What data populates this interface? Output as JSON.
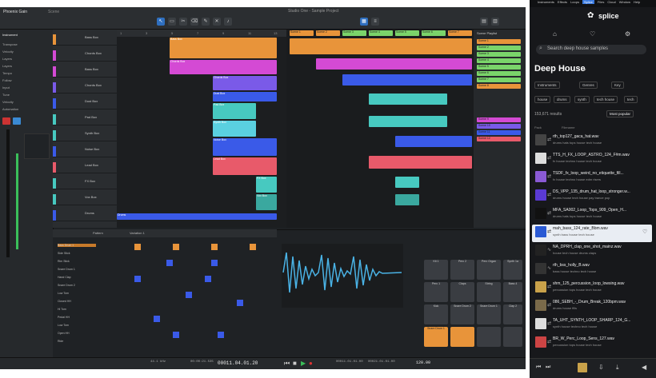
{
  "daw": {
    "project": "Phoenix Gain",
    "project_sub": "Scene",
    "window_title": "Studio One - Sample Project",
    "inspector_title": "Instrument",
    "inspector_rows": [
      "Transpose",
      "Velocity",
      "Layers",
      "Layers",
      "Tempo",
      "Follow",
      "Input",
      "Tune",
      "Velocity",
      "Automation"
    ],
    "tracks": [
      {
        "name": "Bass Box",
        "color": "#e8943a"
      },
      {
        "name": "Chords Box",
        "color": "#d44ad4"
      },
      {
        "name": "Bass Box",
        "color": "#d44ad4"
      },
      {
        "name": "Chords Box",
        "color": "#7a5ae8"
      },
      {
        "name": "Dust Box",
        "color": "#3a5ae8"
      },
      {
        "name": "Pad Box",
        "color": "#47c9c0"
      },
      {
        "name": "Synth Box",
        "color": "#47c9c0"
      },
      {
        "name": "Noise Box",
        "color": "#3a5ae8"
      },
      {
        "name": "Lead Box",
        "color": "#e85a6a"
      },
      {
        "name": "FX Box",
        "color": "#47c9c0"
      },
      {
        "name": "Vox Box",
        "color": "#47c9c0"
      },
      {
        "name": "Drums",
        "color": "#3a5ae8"
      }
    ],
    "ruler_marks": [
      "1",
      "3",
      "5",
      "7",
      "9",
      "11",
      "13"
    ],
    "scene_headers": [
      "Scene 1",
      "Scene 2",
      "Scene 3",
      "Scene 4",
      "Scene 5",
      "Scene 6",
      "Scene 7"
    ],
    "scene_panel_title": "Scene Playlist",
    "scene_items": [
      "Scene 1",
      "Scene 2",
      "Scene 3",
      "Scene 4",
      "Scene 5",
      "Scene 6",
      "Scene 7",
      "Scene 8",
      "Scene 9",
      "Scene 10",
      "Scene 11",
      "Scene 12"
    ],
    "pattern_label": "Pattern",
    "pattern_name": "Variation 1",
    "pattern_rows": [
      "Bass Drum 1",
      "Side Stick",
      "Rim Stick",
      "Snare Drum 1",
      "Hand Clap",
      "Snare Drum 2",
      "Low Tom",
      "Closed HH",
      "Hi Tom",
      "Pedal HH",
      "Low Tom",
      "Open HH",
      "Ride"
    ],
    "pad_labels": [
      "Kit 1",
      "Perc 2",
      "Perc Organ",
      "Synth 1a",
      "Perc 1",
      "Claps",
      "String",
      "Bass 4",
      "Kick",
      "Snare Drum 2",
      "Snare Drum 1",
      "Clap 2",
      "Snare Drum 1",
      "",
      "",
      ""
    ],
    "transport": {
      "time": "00011.04.01.20",
      "tempo": "44.1 kHz",
      "samples": "00:00:21.535",
      "position": "00011.01.01.00",
      "loop_end": "00021.01.01.00",
      "bpm": "120.00"
    }
  },
  "splice": {
    "menu": [
      "Instruments",
      "Effects",
      "Loops",
      "Splice",
      "Files",
      "Cloud",
      "Window",
      "Help"
    ],
    "logo": "splice",
    "search_placeholder": "Search deep house samples",
    "genre_title": "Deep House",
    "filters": [
      "Instruments",
      "Genres",
      "Key"
    ],
    "tags": [
      "house",
      "drums",
      "synth",
      "tech house",
      "tech"
    ],
    "results_count": "153,671 results",
    "sort": "Most popular",
    "col_pack": "Pack",
    "col_filename": "Filename",
    "samples": [
      {
        "name": "rth_top127_gaca_hat.wav",
        "tags": "drums  hats  tops  house  tech house"
      },
      {
        "name": "TTS_H_FX_LOOP_ASTRO_124_F#m.wav",
        "tags": "fx  house  techno  house  tech house"
      },
      {
        "name": "TSDF_fx_loop_weird_no_etiquette_fill...",
        "tags": "fx  house  techno  house  edm  risers"
      },
      {
        "name": "DS_VPP_135_drum_hat_loop_stronger.w...",
        "tags": "drums  house  tech house  pay trance  pop"
      },
      {
        "name": "MFA_SA002_Loop_Tops_909_Open_H...",
        "tags": "drums  hats  tops  house  tech house"
      },
      {
        "name": "mah_bass_124_rate_Bbm.wav",
        "tags": "synth  bass  house  tech house"
      },
      {
        "name": "NA_DPRH_clap_one_shot_mainz.wav",
        "tags": "house  tech house  drums  claps"
      },
      {
        "name": "rth_bss_holly_B.wav",
        "tags": "bass  house  techno  tech house"
      },
      {
        "name": "shm_125_percussion_loop_lowsing.wav",
        "tags": "percussion  tops  house  tech house"
      },
      {
        "name": "086_SEBH_-_Drum_Break_120bpm.wav",
        "tags": "drums  house  fills"
      },
      {
        "name": "TA_UHT_SYNTH_LOOP_SHARP_124_G...",
        "tags": "synth  house  techno  tech house"
      },
      {
        "name": "BR_W_Perc_Loop_Sens_127.wav",
        "tags": "percussion  tops  house  tech house"
      }
    ],
    "colors": {
      "accent": "#3b7be0",
      "bg": "#17181b"
    }
  }
}
